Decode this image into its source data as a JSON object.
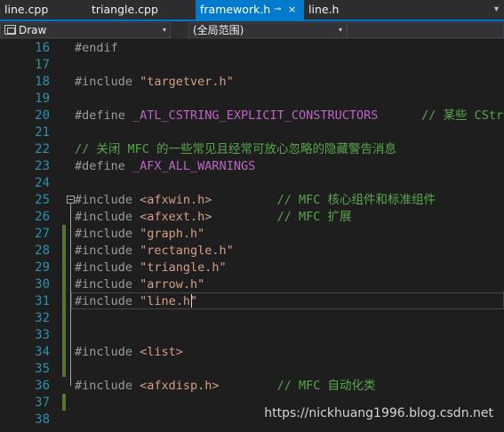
{
  "tabs": [
    {
      "label": "line.cpp",
      "active": false
    },
    {
      "label": "triangle.cpp",
      "active": false
    },
    {
      "label": "framework.h",
      "active": true,
      "pin": "⊸",
      "close": "×"
    },
    {
      "label": "line.h",
      "active": false
    }
  ],
  "tab_overflow": "▾",
  "nav": {
    "class_dropdown": "Draw",
    "scope_dropdown": "(全局范围)",
    "caret": "▾"
  },
  "editor": {
    "lines": [
      {
        "num": "16",
        "tokens": [
          {
            "t": "#endif",
            "c": "kw"
          }
        ]
      },
      {
        "num": "17",
        "tokens": []
      },
      {
        "num": "18",
        "tokens": [
          {
            "t": "#include ",
            "c": "kw"
          },
          {
            "t": "\"targetver.h\"",
            "c": "str"
          }
        ]
      },
      {
        "num": "19",
        "tokens": []
      },
      {
        "num": "20",
        "tokens": [
          {
            "t": "#define ",
            "c": "kw"
          },
          {
            "t": "_ATL_CSTRING_EXPLICIT_CONSTRUCTORS",
            "c": "mac"
          },
          {
            "t": "      // 某些 CStrin",
            "c": "cm"
          }
        ]
      },
      {
        "num": "21",
        "tokens": []
      },
      {
        "num": "22",
        "tokens": [
          {
            "t": "// 关闭 MFC 的一些常见且经常可放心忽略的隐藏警告消息",
            "c": "cm"
          }
        ]
      },
      {
        "num": "23",
        "tokens": [
          {
            "t": "#define ",
            "c": "kw"
          },
          {
            "t": "_AFX_ALL_WARNINGS",
            "c": "mac"
          }
        ]
      },
      {
        "num": "24",
        "tokens": []
      },
      {
        "num": "25",
        "tokens": [
          {
            "t": "#include ",
            "c": "kw"
          },
          {
            "t": "<afxwin.h>",
            "c": "str"
          },
          {
            "t": "         // MFC 核心组件和标准组件",
            "c": "cm"
          }
        ]
      },
      {
        "num": "26",
        "tokens": [
          {
            "t": "#include ",
            "c": "kw"
          },
          {
            "t": "<afxext.h>",
            "c": "str"
          },
          {
            "t": "         // MFC 扩展",
            "c": "cm"
          }
        ]
      },
      {
        "num": "27",
        "tokens": [
          {
            "t": "#include ",
            "c": "kw"
          },
          {
            "t": "\"graph.h\"",
            "c": "str"
          }
        ]
      },
      {
        "num": "28",
        "tokens": [
          {
            "t": "#include ",
            "c": "kw"
          },
          {
            "t": "\"rectangle.h\"",
            "c": "str"
          }
        ]
      },
      {
        "num": "29",
        "tokens": [
          {
            "t": "#include ",
            "c": "kw"
          },
          {
            "t": "\"triangle.h\"",
            "c": "str"
          }
        ]
      },
      {
        "num": "30",
        "tokens": [
          {
            "t": "#include ",
            "c": "kw"
          },
          {
            "t": "\"arrow.h\"",
            "c": "str"
          }
        ]
      },
      {
        "num": "31",
        "tokens": [
          {
            "t": "#include ",
            "c": "kw"
          },
          {
            "t": "\"line.h\"",
            "c": "str"
          }
        ]
      },
      {
        "num": "32",
        "tokens": []
      },
      {
        "num": "33",
        "tokens": []
      },
      {
        "num": "34",
        "tokens": [
          {
            "t": "#include ",
            "c": "kw"
          },
          {
            "t": "<list>",
            "c": "str"
          }
        ]
      },
      {
        "num": "35",
        "tokens": []
      },
      {
        "num": "36",
        "tokens": [
          {
            "t": "#include ",
            "c": "kw"
          },
          {
            "t": "<afxdisp.h>",
            "c": "str"
          },
          {
            "t": "        // MFC 自动化类",
            "c": "cm"
          }
        ]
      },
      {
        "num": "37",
        "tokens": []
      },
      {
        "num": "38",
        "tokens": []
      }
    ],
    "current_line": "31"
  },
  "watermark": "https://nickhuang1996.blog.csdn.net",
  "colors": {
    "background": "#1e1e1e",
    "accent": "#007acc",
    "line_number": "#2b91af",
    "keyword": "#9b9b9b",
    "string": "#d69d85",
    "macro": "#be63c7",
    "comment": "#57a64a",
    "change_bar": "#577430"
  }
}
